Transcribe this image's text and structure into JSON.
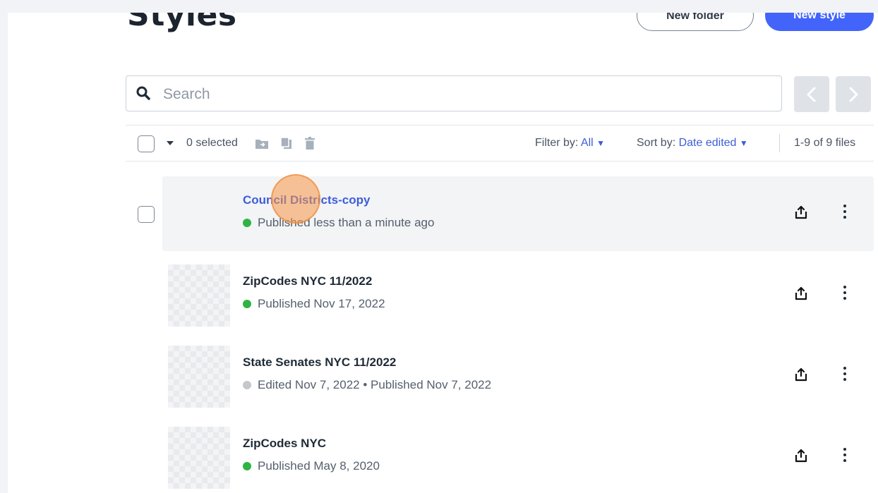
{
  "header": {
    "title": "Styles",
    "new_folder_label": "New folder",
    "new_style_label": "New style"
  },
  "search": {
    "placeholder": "Search",
    "value": ""
  },
  "toolbar": {
    "selected_count": "0 selected",
    "filter_label": "Filter by:",
    "filter_value": "All",
    "sort_label": "Sort by:",
    "sort_value": "Date edited",
    "file_count": "1-9 of 9 files"
  },
  "colors": {
    "accent": "#4264fb",
    "link": "#3e5dd8",
    "published": "#2fb344",
    "edited": "#c4c8cd"
  },
  "styles": [
    {
      "name": "Council Districts-copy",
      "status": "Published less than a minute ago",
      "status_color": "#2fb344"
    },
    {
      "name": "ZipCodes NYC 11/2022",
      "status": "Published Nov 17, 2022",
      "status_color": "#2fb344"
    },
    {
      "name": "State Senates NYC 11/2022",
      "status": "Edited Nov 7, 2022 • Published Nov 7, 2022",
      "status_color": "#c4c8cd"
    },
    {
      "name": "ZipCodes NYC",
      "status": "Published May 8, 2020",
      "status_color": "#2fb344"
    }
  ]
}
